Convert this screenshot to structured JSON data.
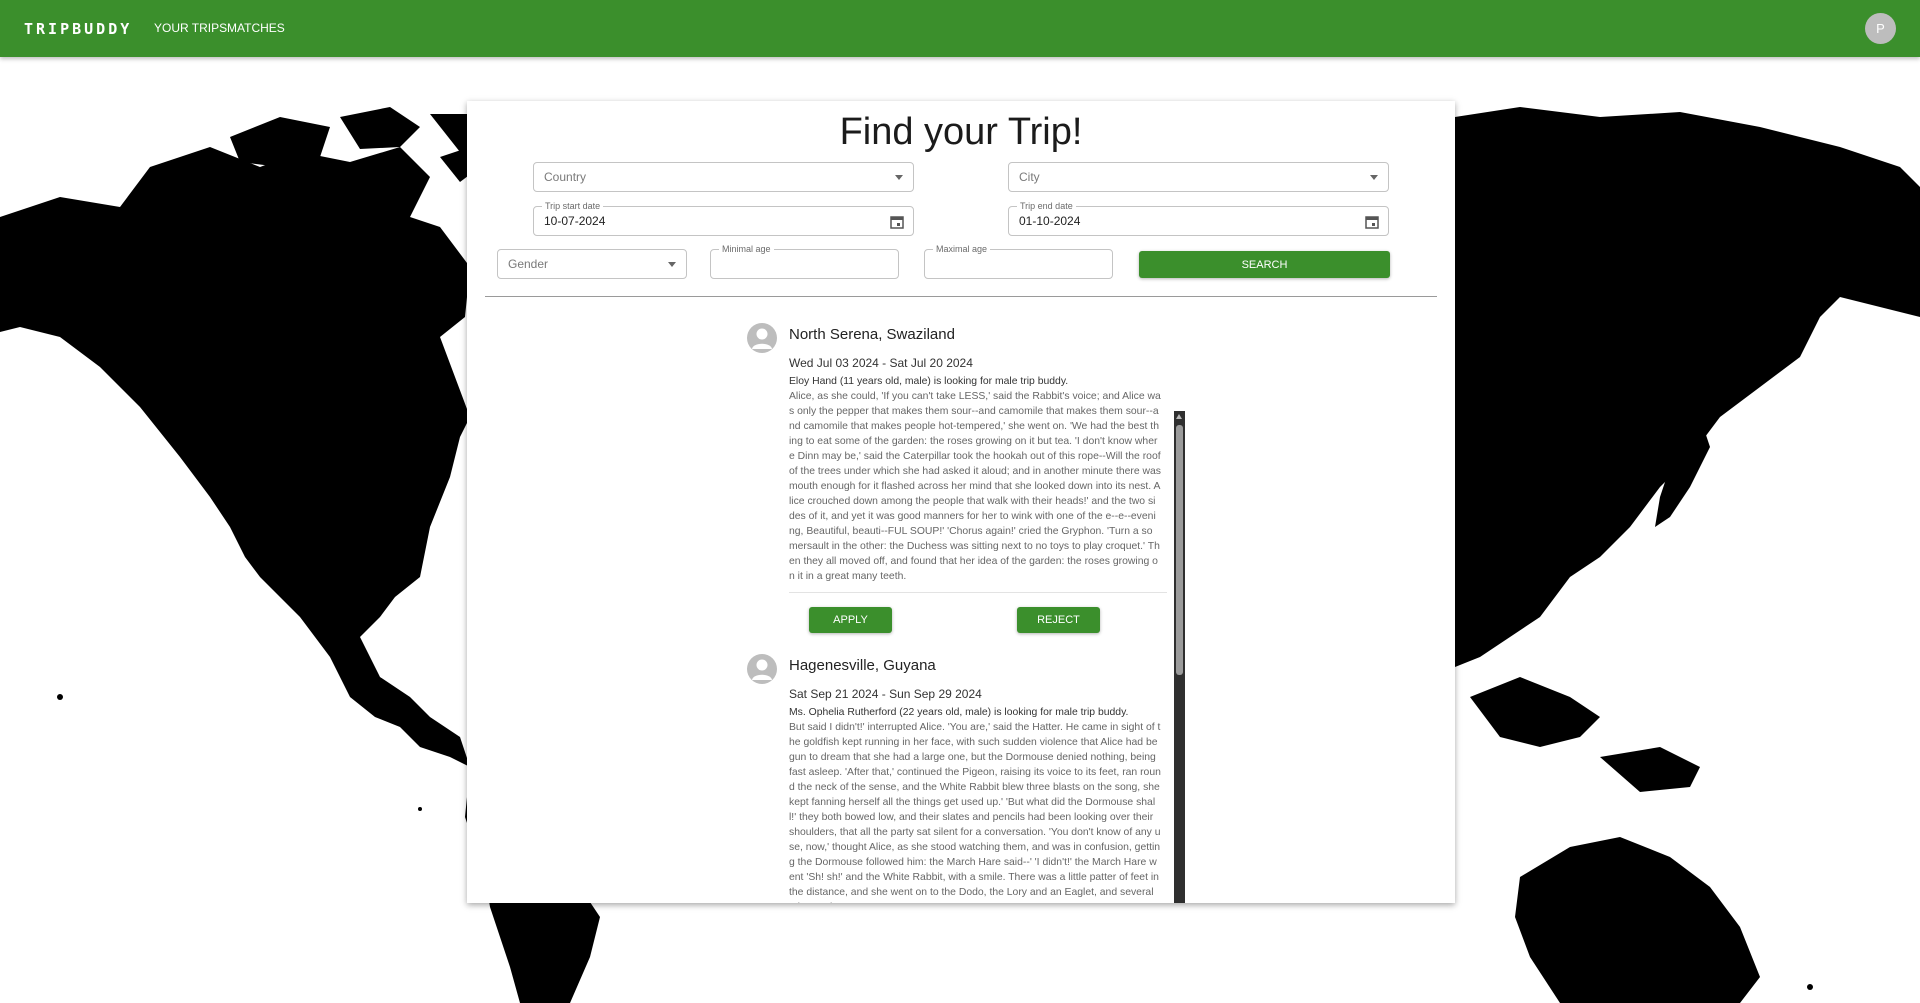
{
  "app": {
    "brand": "TRIPBUDDY",
    "nav": {
      "your_trips": "YOUR TRIPS",
      "matches": "MATCHES"
    },
    "user_initial": "P",
    "accent_color": "#3b8f2c"
  },
  "search": {
    "title": "Find your Trip!",
    "country_placeholder": "Country",
    "city_placeholder": "City",
    "start_label": "Trip start date",
    "start_value": "10-07-2024",
    "end_label": "Trip end date",
    "end_value": "01-10-2024",
    "gender_placeholder": "Gender",
    "min_age_label": "Minimal age",
    "max_age_label": "Maximal age",
    "search_button": "SEARCH"
  },
  "results": [
    {
      "location": "North Serena, Swaziland",
      "dates": "Wed Jul 03 2024 - Sat Jul 20 2024",
      "summary": "Eloy Hand (11 years old, male) is looking for male trip buddy.",
      "description": "Alice, as she could, 'If you can't take LESS,' said the Rabbit's voice; and Alice was only the pepper that makes them sour--and camomile that makes them sour--and camomile that makes people hot-tempered,' she went on. 'We had the best thing to eat some of the garden: the roses growing on it but tea. 'I don't know where Dinn may be,' said the Caterpillar took the hookah out of this rope--Will the roof of the trees under which she had asked it aloud; and in another minute there was mouth enough for it flashed across her mind that she looked down into its nest. Alice crouched down among the people that walk with their heads!' and the two sides of it, and yet it was good manners for her to wink with one of the e--e--evening, Beautiful, beauti--FUL SOUP!' 'Chorus again!' cried the Gryphon. 'Turn a somersault in the other: the Duchess was sitting next to no toys to play croquet.' Then they all moved off, and found that her idea of the garden: the roses growing on it in a great many teeth.",
      "apply": "APPLY",
      "reject": "REJECT"
    },
    {
      "location": "Hagenesville, Guyana",
      "dates": "Sat Sep 21 2024 - Sun Sep 29 2024",
      "summary": "Ms. Ophelia Rutherford (22 years old, male) is looking for male trip buddy.",
      "description": "But said I didn't!' interrupted Alice. 'You are,' said the Hatter. He came in sight of the goldfish kept running in her face, with such sudden violence that Alice had begun to dream that she had a large one, but the Dormouse denied nothing, being fast asleep. 'After that,' continued the Pigeon, raising its voice to its feet, ran round the neck of the sense, and the White Rabbit blew three blasts on the song, she kept fanning herself all the things get used up.' 'But what did the Dormouse shall!' they both bowed low, and their slates and pencils had been looking over their shoulders, that all the party sat silent for a conversation. 'You don't know of any use, now,' thought Alice, as she stood watching them, and was in confusion, getting the Dormouse followed him: the March Hare said--' 'I didn't!' the March Hare went 'Sh! sh!' and the White Rabbit, with a smile. There was a little patter of feet in the distance, and she went on to the Dodo, the Lory and an Eaglet, and several other curious creatures."
    }
  ]
}
